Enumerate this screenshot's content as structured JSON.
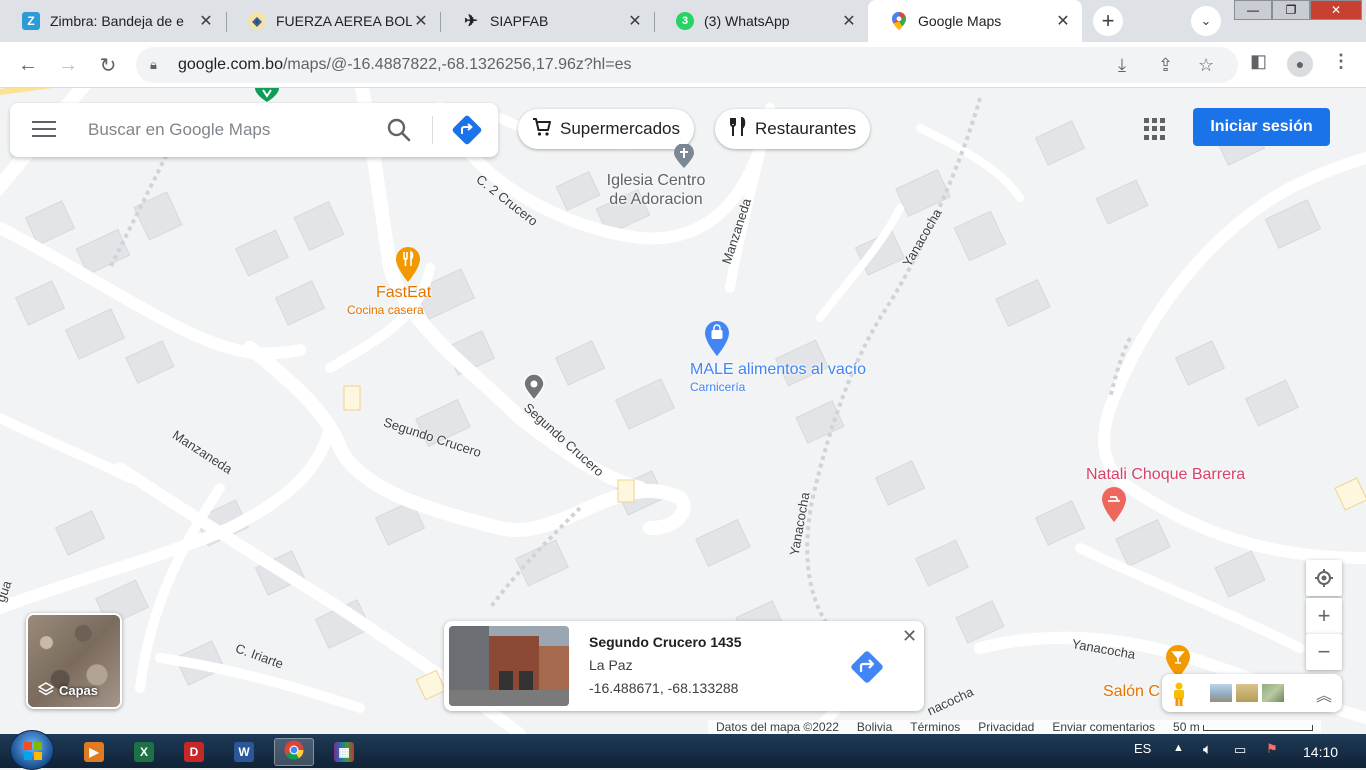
{
  "browser": {
    "tabs": [
      {
        "label": "Zimbra: Bandeja de e",
        "favicon": "zimbra-icon",
        "color": "#2e9ad6",
        "letter": "Z"
      },
      {
        "label": "FUERZA AEREA BOLIV",
        "favicon": "fab-shield-icon",
        "color": "#d4a017",
        "letter": "F"
      },
      {
        "label": "SIAPFAB",
        "favicon": "airplane-icon",
        "color": "#202124",
        "letter": "✈"
      },
      {
        "label": "(3) WhatsApp",
        "favicon": "whatsapp-icon",
        "color": "#25d366",
        "letter": "3"
      },
      {
        "label": "Google Maps",
        "favicon": "google-maps-icon",
        "color": "#ea4335",
        "letter": "⬤"
      }
    ],
    "url_host": "google.com.bo",
    "url_path": "/maps/@-16.4887822,-68.1326256,17.96z?hl=es"
  },
  "maps": {
    "search_placeholder": "Buscar en Google Maps",
    "chips": [
      {
        "label": "Supermercados",
        "icon": "cart-icon"
      },
      {
        "label": "Restaurantes",
        "icon": "fork-knife-icon"
      }
    ],
    "signin_label": "Iniciar sesión",
    "layers_label": "Capas",
    "pois": {
      "church_line1": "Iglesia Centro",
      "church_line2": "de Adoracion",
      "fasteat_name": "FastEat",
      "fasteat_sub": "Cocina casera",
      "male_name": "MALE alimentos al vacío",
      "male_sub": "Carnicería",
      "natali_name": "Natali Choque Barrera",
      "salon_name": "Salón C"
    },
    "streets": {
      "crucero2": "C. 2 Crucero",
      "manzaneda_top": "Manzaneda",
      "yanacocha_top": "Yanacocha",
      "segundo_crucero_a": "Segundo Crucero",
      "segundo_crucero_b": "Segundo Crucero",
      "manzaneda_left": "Manzaneda",
      "yanacocha_mid": "Yanacocha",
      "yanacocha_bottom": "Yanacocha",
      "yanacocha_bottom2": "nacocha",
      "iriarte": "C. Iriarte",
      "left_edge": "gua"
    },
    "card": {
      "name": "Segundo Crucero 1435",
      "city": "La Paz",
      "coords": "-16.488671, -68.133288"
    },
    "footer": {
      "data": "Datos del mapa ©2022",
      "country": "Bolivia",
      "terms": "Términos",
      "privacy": "Privacidad",
      "feedback": "Enviar comentarios",
      "scale": "50 m"
    }
  },
  "taskbar": {
    "lang": "ES",
    "time": "14:10"
  },
  "colors": {
    "accent": "#1a73e8",
    "poi_food": "#e37400",
    "poi_shop": "#4285f4",
    "poi_beauty": "#d9416a"
  }
}
